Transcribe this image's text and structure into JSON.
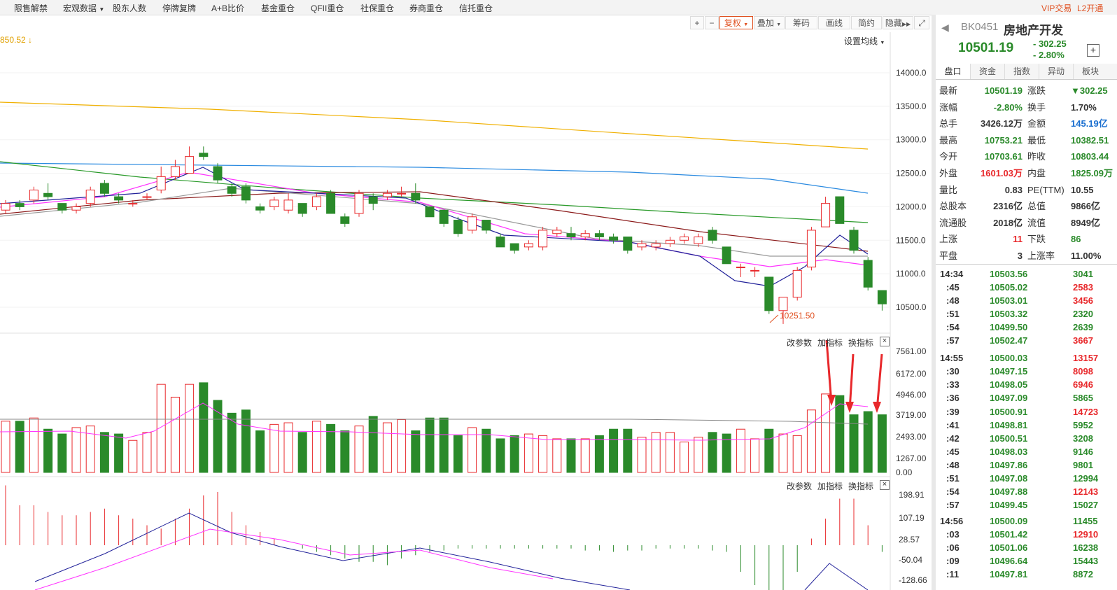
{
  "topbar": {
    "menus": [
      "限售解禁",
      "宏观数据",
      "股东人数",
      "停牌复牌",
      "A+B比价",
      "基金重仓",
      "QFII重仓",
      "社保重仓",
      "券商重仓",
      "信托重仓"
    ],
    "vip": "VIP交易",
    "l2": "L2开通"
  },
  "toolbar": {
    "zoom_in": "+",
    "zoom_out": "−",
    "fuquan": "复权",
    "diejia": "叠加",
    "chouma": "筹码",
    "huaxian": "画线",
    "jianyue": "简约",
    "yincang": "隐藏",
    "ma_setting": "设置均线",
    "ma_value": "850.52"
  },
  "main_chart": {
    "y_ticks": [
      "14000.0",
      "13500.0",
      "13000.0",
      "12500.0",
      "12000.0",
      "11500.0",
      "11000.0",
      "10500.0"
    ],
    "low_label": "10251.50"
  },
  "indicator_links": {
    "params": "改参数",
    "add": "加指标",
    "swap": "换指标",
    "close": "×"
  },
  "volume_chart": {
    "y_ticks": [
      "7561.00",
      "6172.00",
      "4946.00",
      "3719.00",
      "2493.00",
      "1267.00",
      "0.00"
    ]
  },
  "macd_chart": {
    "y_ticks": [
      "198.91",
      "107.19",
      "28.57",
      "-50.04",
      "-128.66"
    ]
  },
  "quote": {
    "code": "BK0451",
    "name": "房地产开发",
    "price": "10501.19",
    "change": "- 302.25",
    "change_pct": "- 2.80%",
    "tabs": [
      "盘口",
      "资金",
      "指数",
      "异动",
      "板块"
    ],
    "rows": [
      {
        "l1": "最新",
        "v1": "10501.19",
        "l2": "涨跌",
        "v2": "▼302.25"
      },
      {
        "l1": "涨幅",
        "v1": "-2.80%",
        "l2": "换手",
        "v2": "1.70%"
      },
      {
        "l1": "总手",
        "v1": "3426.12万",
        "l2": "金额",
        "v2": "145.19亿"
      },
      {
        "l1": "最高",
        "v1": "10753.21",
        "l2": "最低",
        "v2": "10382.51"
      },
      {
        "l1": "今开",
        "v1": "10703.61",
        "l2": "昨收",
        "v2": "10803.44"
      },
      {
        "l1": "外盘",
        "v1": "1601.03万",
        "l2": "内盘",
        "v2": "1825.09万"
      },
      {
        "l1": "量比",
        "v1": "0.83",
        "l2": "PE(TTM)",
        "v2": "10.55"
      },
      {
        "l1": "总股本",
        "v1": "2316亿",
        "l2": "总值",
        "v2": "9866亿"
      },
      {
        "l1": "流通股",
        "v1": "2018亿",
        "l2": "流值",
        "v2": "8949亿"
      },
      {
        "l1": "上涨",
        "v1": "11",
        "l2": "下跌",
        "v2": "86"
      },
      {
        "l1": "平盘",
        "v1": "3",
        "l2": "上涨率",
        "v2": "11.00%"
      }
    ],
    "ticks": [
      {
        "t": "14:34",
        "p": "10503.56",
        "v": "3041"
      },
      {
        "t": ":45",
        "p": "10505.02",
        "v": "2583"
      },
      {
        "t": ":48",
        "p": "10503.01",
        "v": "3456"
      },
      {
        "t": ":51",
        "p": "10503.32",
        "v": "2320"
      },
      {
        "t": ":54",
        "p": "10499.50",
        "v": "2639"
      },
      {
        "t": ":57",
        "p": "10502.47",
        "v": "3667"
      },
      {
        "t": "14:55",
        "p": "10500.03",
        "v": "13157"
      },
      {
        "t": ":30",
        "p": "10497.15",
        "v": "8098"
      },
      {
        "t": ":33",
        "p": "10498.05",
        "v": "6946"
      },
      {
        "t": ":36",
        "p": "10497.09",
        "v": "5865"
      },
      {
        "t": ":39",
        "p": "10500.91",
        "v": "14723"
      },
      {
        "t": ":41",
        "p": "10498.81",
        "v": "5952"
      },
      {
        "t": ":42",
        "p": "10500.51",
        "v": "3208"
      },
      {
        "t": ":45",
        "p": "10498.03",
        "v": "9146"
      },
      {
        "t": ":48",
        "p": "10497.86",
        "v": "9801"
      },
      {
        "t": ":51",
        "p": "10497.08",
        "v": "12994"
      },
      {
        "t": ":54",
        "p": "10497.88",
        "v": "12143"
      },
      {
        "t": ":57",
        "p": "10499.45",
        "v": "15027"
      },
      {
        "t": "14:56",
        "p": "10500.09",
        "v": "11455"
      },
      {
        "t": ":03",
        "p": "10501.42",
        "v": "12910"
      },
      {
        "t": ":06",
        "p": "10501.06",
        "v": "16238"
      },
      {
        "t": ":09",
        "p": "10496.64",
        "v": "15443"
      },
      {
        "t": ":11",
        "p": "10497.81",
        "v": "8872"
      }
    ]
  },
  "colors": {
    "up": "#e8282b",
    "down": "#2a8a2a",
    "accent": "#e05020"
  }
}
